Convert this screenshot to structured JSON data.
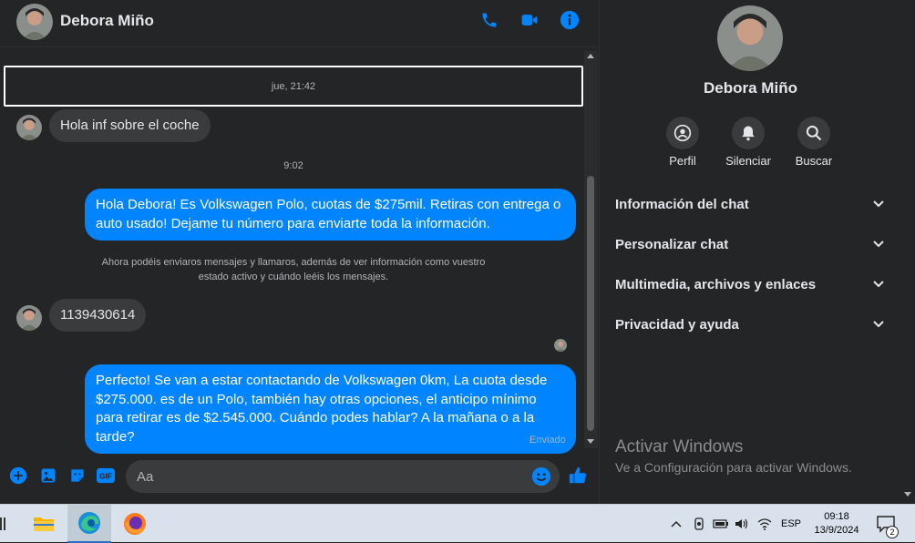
{
  "contact": {
    "name": "Debora Miño"
  },
  "chat": {
    "date_divider": "jue, 21:42",
    "msg1": "Hola inf sobre el coche",
    "time2": "9:02",
    "msg2": "Hola Debora! Es Volkswagen Polo, cuotas de $275mil. Retiras con entrega o auto usado! Dejame tu número para enviarte toda la información.",
    "notice": "Ahora podéis enviaros mensajes y llamaros, además de ver información como vuestro estado activo y cuándo leéis los mensajes.",
    "msg3": "1139430614",
    "msg4": "Perfecto!  Se van a estar contactando de Volkswagen 0km, La cuota desde $275.000. es de un Polo, también hay otras opciones, el anticipo mínimo para retirar es de $2.545.000. Cuándo podes hablar? A la mañana o a la tarde?",
    "status": "Enviado"
  },
  "composer": {
    "placeholder": "Aa"
  },
  "info": {
    "actions": [
      {
        "label": "Perfil",
        "icon": "profile-icon"
      },
      {
        "label": "Silenciar",
        "icon": "bell-icon"
      },
      {
        "label": "Buscar",
        "icon": "search-icon"
      }
    ],
    "sections": [
      "Información del chat",
      "Personalizar chat",
      "Multimedia, archivos y enlaces",
      "Privacidad y ayuda"
    ]
  },
  "watermark": {
    "title": "Activar Windows",
    "subtitle": "Ve a Configuración para activar Windows."
  },
  "taskbar": {
    "lang": "ESP",
    "time": "09:18",
    "date": "13/9/2024",
    "notifications": "2"
  },
  "colors": {
    "accent": "#0084ff",
    "background": "#242526",
    "bubble_in": "#3a3b3c"
  }
}
